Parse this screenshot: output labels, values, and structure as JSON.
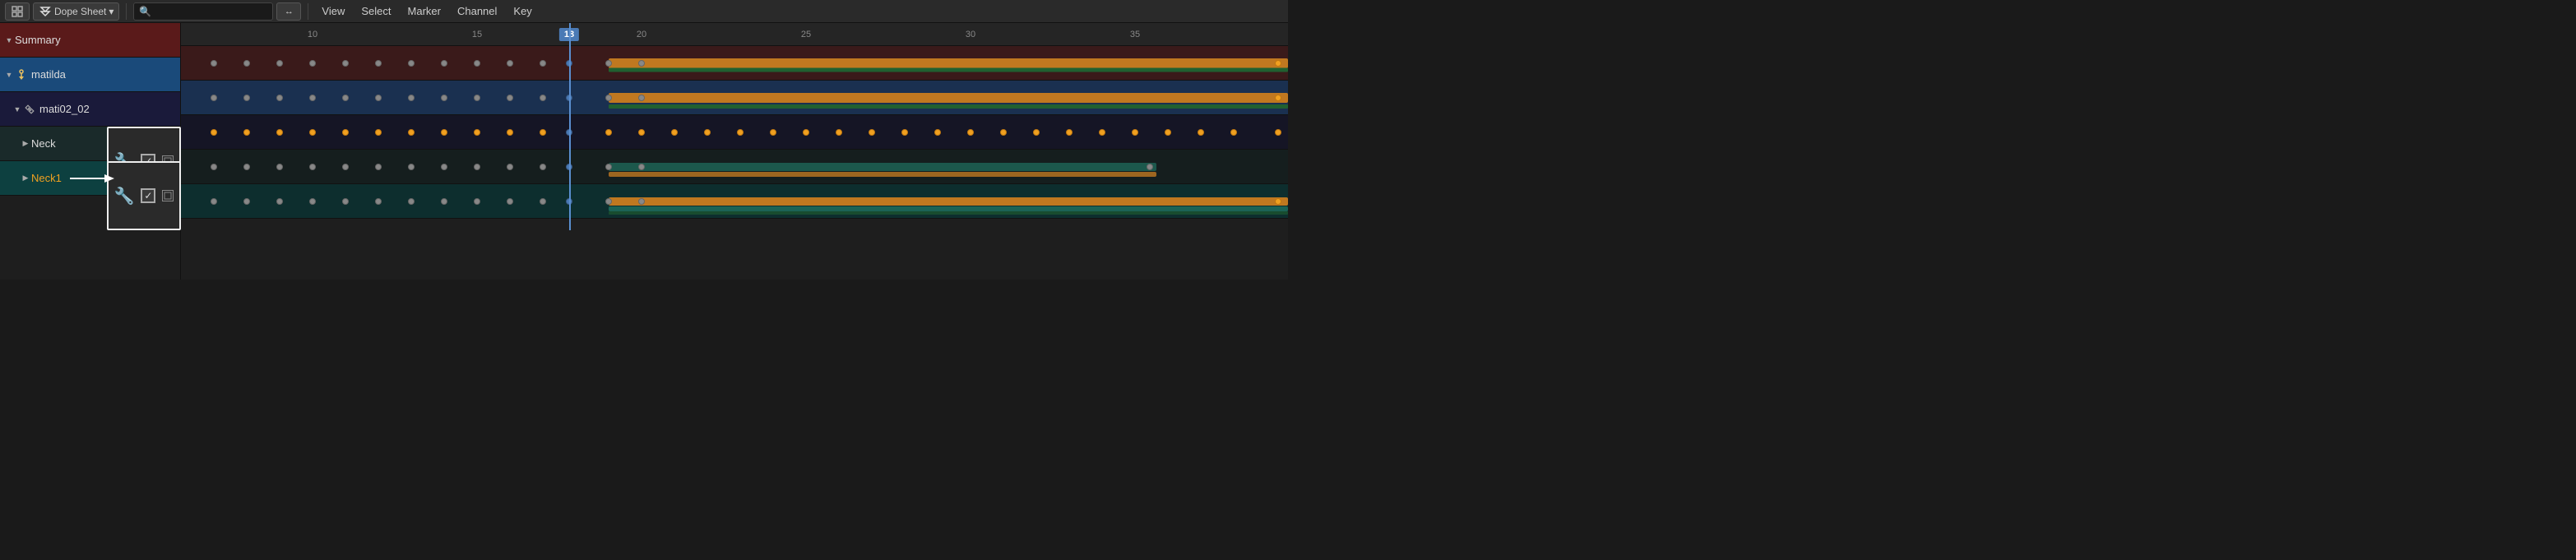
{
  "toolbar": {
    "editor_type": "Dope Sheet",
    "menus": [
      "View",
      "Select",
      "Marker",
      "Channel",
      "Key"
    ],
    "search_placeholder": "Search",
    "swap_label": "↔"
  },
  "channels": [
    {
      "id": "summary",
      "label": "Summary",
      "indent": 0,
      "expanded": true,
      "icon": "triangle-down",
      "color_class": "row-summary",
      "label_color": "white"
    },
    {
      "id": "matilda",
      "label": "matilda",
      "indent": 0,
      "expanded": true,
      "icon": "armature",
      "color_class": "row-matilda",
      "label_color": "white"
    },
    {
      "id": "mati02",
      "label": "mati02_02",
      "indent": 1,
      "expanded": true,
      "icon": "linked-diamond",
      "color_class": "row-mati02",
      "label_color": "white"
    },
    {
      "id": "neck",
      "label": "Neck",
      "indent": 2,
      "expanded": false,
      "icon": "triangle-right",
      "color_class": "row-neck",
      "label_color": "white"
    },
    {
      "id": "neck1",
      "label": "Neck1",
      "indent": 2,
      "expanded": false,
      "icon": "triangle-right",
      "color_class": "row-neck1",
      "label_color": "yellow"
    }
  ],
  "frame_numbers": [
    10,
    15,
    18,
    20,
    25,
    30,
    35
  ],
  "current_frame": 18,
  "popup": {
    "visible": true,
    "row": "neck",
    "wrench_label": "🔧",
    "checkbox_checked": true
  },
  "colors": {
    "summary_bg": "#5a1a1a",
    "matilda_bg": "#1a4a7a",
    "mati02_bg": "#1a1a3a",
    "neck_bg": "#1a2a2a",
    "neck1_bg": "#0d4040",
    "orange_strip": "#c07820",
    "teal_strip": "#207060",
    "current_frame_line": "#5a8fd0",
    "frame_highlight": "#4a7ab5"
  }
}
